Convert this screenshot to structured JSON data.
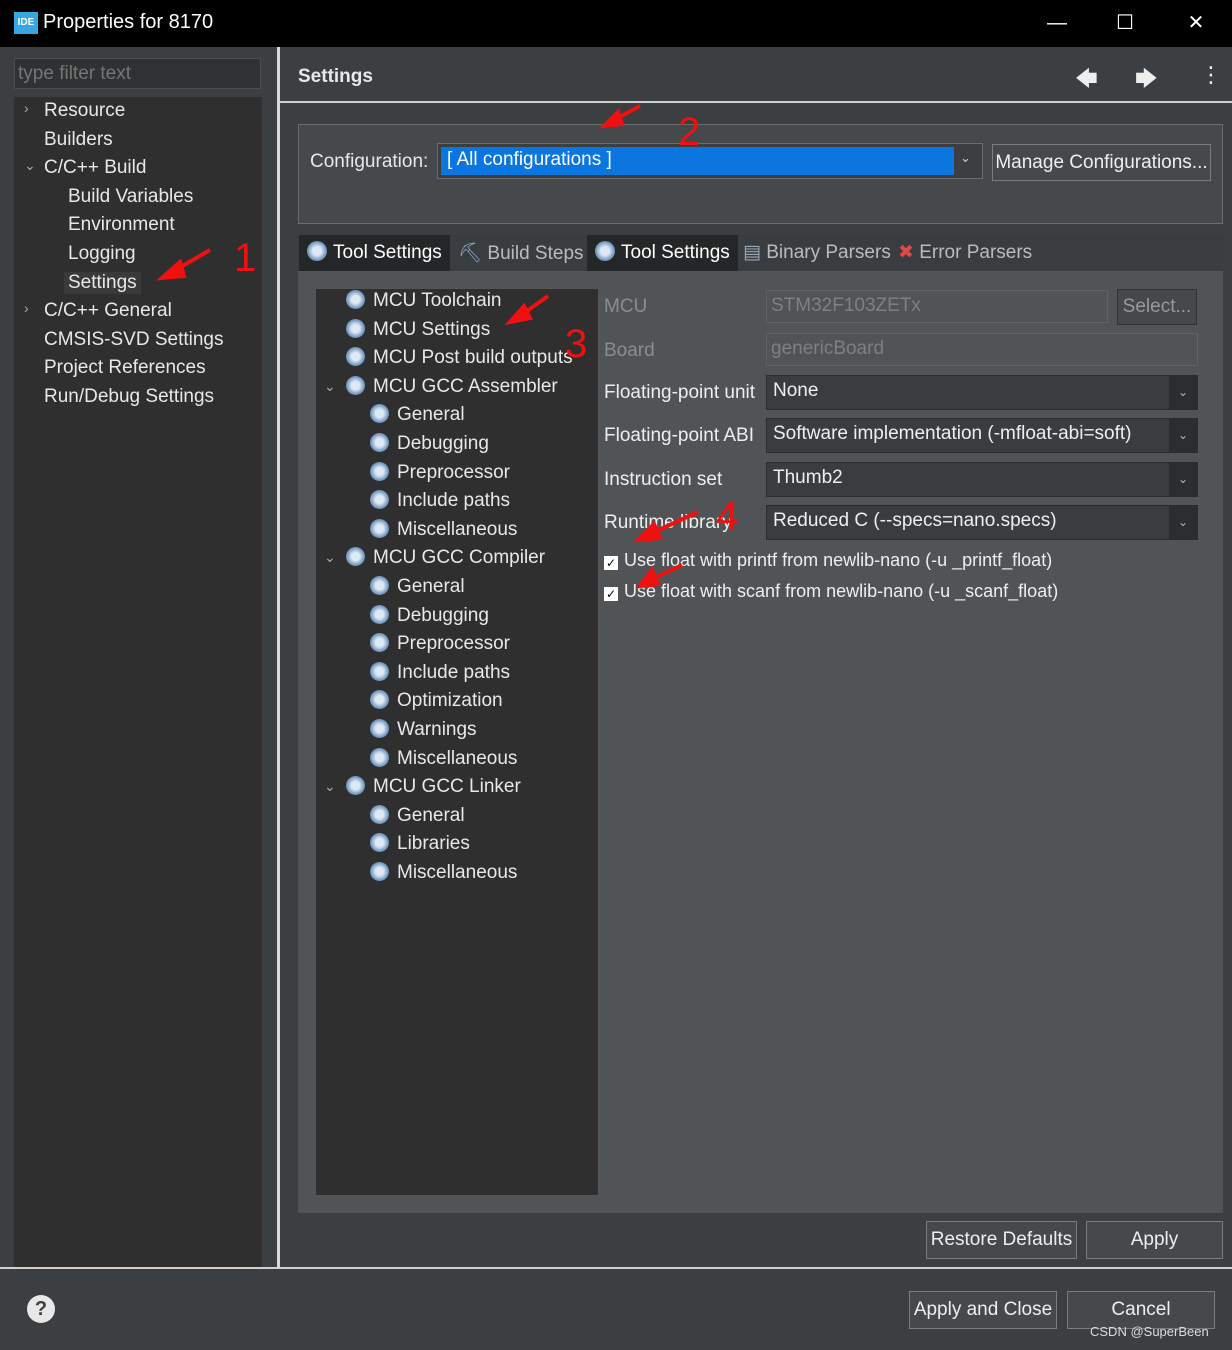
{
  "window": {
    "title": "Properties for 8170",
    "logo": "IDE",
    "minimize": "—",
    "maximize": "☐",
    "close": "✕"
  },
  "left": {
    "filter_placeholder": "type filter text",
    "items": [
      {
        "label": "Resource",
        "chevron": "›"
      },
      {
        "label": "Builders"
      },
      {
        "label": "C/C++ Build",
        "chevron": "⌄"
      },
      {
        "label": "Build Variables"
      },
      {
        "label": "Environment"
      },
      {
        "label": "Logging"
      },
      {
        "label": "Settings",
        "selected": true
      },
      {
        "label": "C/C++ General",
        "chevron": "›"
      },
      {
        "label": "CMSIS-SVD Settings"
      },
      {
        "label": "Project References"
      },
      {
        "label": "Run/Debug Settings"
      }
    ]
  },
  "header": {
    "title": "Settings",
    "back": "🡄",
    "forward": "🡆",
    "menu": "⋮"
  },
  "configuration": {
    "label": "Configuration:",
    "value": "[ All configurations ]",
    "manage_button": "Manage Configurations..."
  },
  "tabs": [
    {
      "label": "Tool Settings",
      "icon": "gear-icon",
      "active": true
    },
    {
      "label": "Build Steps",
      "icon": "build-steps-icon"
    },
    {
      "label": "Tool Settings",
      "icon": "gear-icon",
      "active": true
    },
    {
      "label": "Binary Parsers",
      "icon": "binary-parser-icon"
    },
    {
      "label": "Error Parsers",
      "icon": "error-parser-icon"
    }
  ],
  "tool_tree": [
    {
      "label": "MCU Toolchain",
      "level": 0
    },
    {
      "label": "MCU Settings",
      "level": 0,
      "selected": true
    },
    {
      "label": "MCU Post build outputs",
      "level": 0
    },
    {
      "label": "MCU GCC Assembler",
      "level": 0,
      "expanded": true
    },
    {
      "label": "General",
      "level": 1
    },
    {
      "label": "Debugging",
      "level": 1
    },
    {
      "label": "Preprocessor",
      "level": 1
    },
    {
      "label": "Include paths",
      "level": 1
    },
    {
      "label": "Miscellaneous",
      "level": 1
    },
    {
      "label": "MCU GCC Compiler",
      "level": 0,
      "expanded": true
    },
    {
      "label": "General",
      "level": 1
    },
    {
      "label": "Debugging",
      "level": 1
    },
    {
      "label": "Preprocessor",
      "level": 1
    },
    {
      "label": "Include paths",
      "level": 1
    },
    {
      "label": "Optimization",
      "level": 1
    },
    {
      "label": "Warnings",
      "level": 1
    },
    {
      "label": "Miscellaneous",
      "level": 1
    },
    {
      "label": "MCU GCC Linker",
      "level": 0,
      "expanded": true
    },
    {
      "label": "General",
      "level": 1
    },
    {
      "label": "Libraries",
      "level": 1
    },
    {
      "label": "Miscellaneous",
      "level": 1
    }
  ],
  "mcu": {
    "mcu_label": "MCU",
    "mcu_value": "STM32F103ZETx",
    "select_button": "Select...",
    "board_label": "Board",
    "board_value": "genericBoard",
    "fpu_label": "Floating-point unit",
    "fpu_value": "None",
    "abi_label": "Floating-point ABI",
    "abi_value": "Software implementation (-mfloat-abi=soft)",
    "iset_label": "Instruction set",
    "iset_value": "Thumb2",
    "runtime_label": "Runtime library",
    "runtime_value": "Reduced C (--specs=nano.specs)",
    "printf_float": "Use float with printf from newlib-nano (-u _printf_float)",
    "printf_checked": true,
    "scanf_float": "Use float with scanf from newlib-nano (-u _scanf_float)",
    "scanf_checked": true
  },
  "buttons": {
    "restore": "Restore Defaults",
    "apply": "Apply",
    "apply_close": "Apply and Close",
    "cancel": "Cancel",
    "help": "?"
  },
  "annotations": {
    "n1": "1",
    "n2": "2",
    "n3": "3",
    "n4": "4",
    "color": "#f01010"
  },
  "watermark": "CSDN @SuperBeen"
}
